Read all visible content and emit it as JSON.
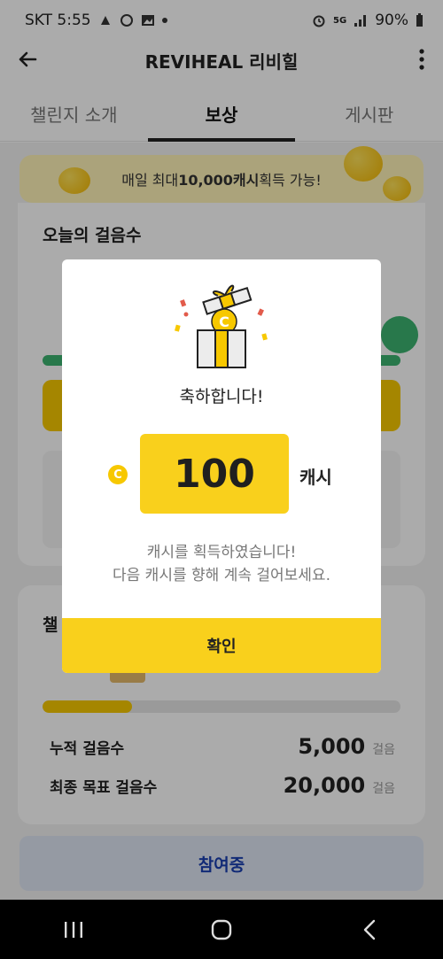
{
  "status_bar": {
    "carrier_time": "SKT 5:55",
    "network": "5G",
    "battery": "90%"
  },
  "header": {
    "title": "REVIHEAL 리비힐"
  },
  "tabs": [
    {
      "label": "챌린지 소개"
    },
    {
      "label": "보상"
    },
    {
      "label": "게시판"
    }
  ],
  "banner": {
    "prefix": "매일 최대 ",
    "highlight": "10,000캐시",
    "suffix": " 획득 가능!"
  },
  "today_card": {
    "title": "오늘의 걸음수"
  },
  "challenge_card": {
    "title": "챌",
    "progress": 0.25,
    "rows": [
      {
        "label": "누적 걸음수",
        "value": "5,000",
        "unit": "걸음"
      },
      {
        "label": "최종 목표 걸음수",
        "value": "20,000",
        "unit": "걸음"
      }
    ]
  },
  "join_button": {
    "label": "참여중"
  },
  "modal": {
    "congrats": "축하합니다!",
    "amount": "100",
    "unit": "캐시",
    "coin_symbol": "C",
    "desc_line1": "캐시를 획득하였습니다!",
    "desc_line2": "다음 캐시를 향해 계속 걸어보세요.",
    "confirm": "확인"
  },
  "colors": {
    "accent": "#f9d01c",
    "join_text": "#1a3fb0",
    "progress_green": "#3cb371"
  }
}
